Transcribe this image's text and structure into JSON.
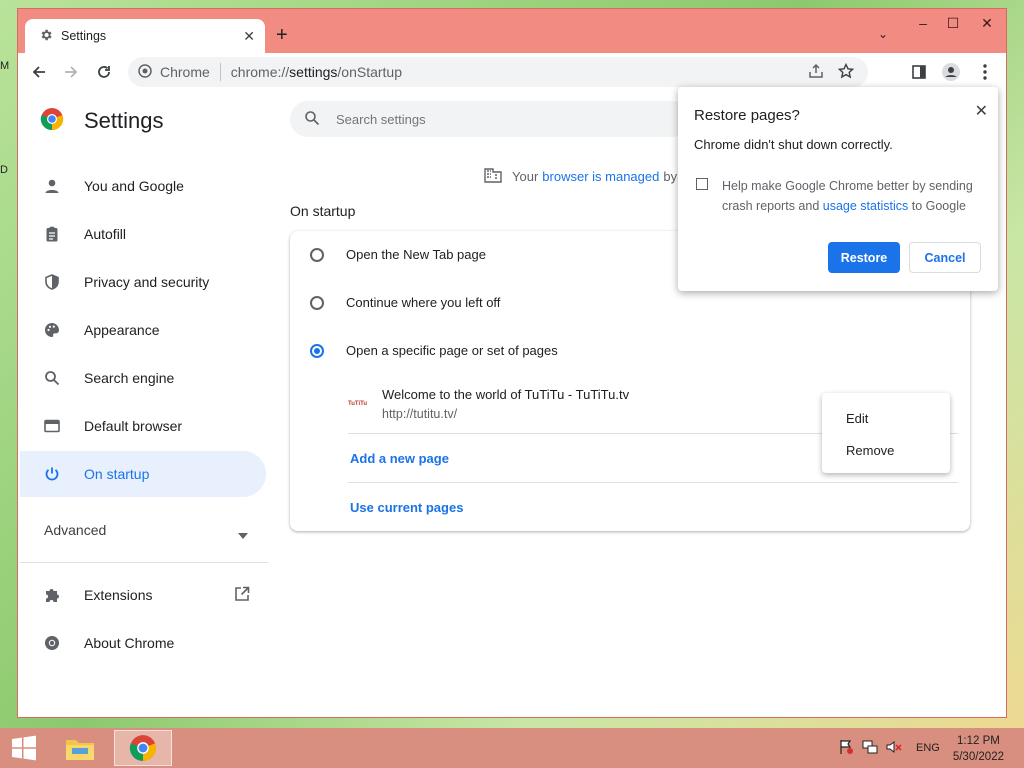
{
  "desktop": {
    "marks": [
      "M",
      "D"
    ]
  },
  "window": {
    "caption_buttons": {
      "minimize": "–",
      "maximize": "☐",
      "close": "✕"
    },
    "tab": {
      "title": "Settings",
      "close": "✕"
    },
    "new_tab": "+",
    "tab_search": "⌄"
  },
  "toolbar": {
    "omnibox": {
      "site": "Chrome",
      "url_prefix": "chrome://",
      "url_host": "settings",
      "url_path": "/onStartup"
    }
  },
  "sidebar": {
    "title": "Settings",
    "items": [
      {
        "label": "You and Google",
        "icon": "person-icon"
      },
      {
        "label": "Autofill",
        "icon": "clipboard-icon"
      },
      {
        "label": "Privacy and security",
        "icon": "shield-icon"
      },
      {
        "label": "Appearance",
        "icon": "palette-icon"
      },
      {
        "label": "Search engine",
        "icon": "search-icon"
      },
      {
        "label": "Default browser",
        "icon": "browser-window-icon"
      },
      {
        "label": "On startup",
        "icon": "power-icon",
        "active": true
      }
    ],
    "advanced": "Advanced",
    "extensions": "Extensions",
    "about": "About Chrome"
  },
  "search": {
    "placeholder": "Search settings"
  },
  "managed": {
    "prefix": "Your",
    "link": "browser is managed",
    "suffix": "by"
  },
  "startup": {
    "section_title": "On startup",
    "options": [
      "Open the New Tab page",
      "Continue where you left off",
      "Open a specific page or set of pages"
    ],
    "selected_index": 2,
    "page": {
      "favicon_text": "TuTiTu",
      "title": "Welcome to the world of TuTiTu - TuTiTu.tv",
      "url": "http://tutitu.tv/"
    },
    "add_page": "Add a new page",
    "use_current": "Use current pages"
  },
  "context_menu": {
    "items": [
      "Edit",
      "Remove"
    ]
  },
  "dialog": {
    "title": "Restore pages?",
    "close": "✕",
    "message": "Chrome didn't shut down correctly.",
    "checkbox_text_1": "Help make Google Chrome better by sending crash reports and",
    "checkbox_link": "usage statistics",
    "checkbox_text_2": "to Google",
    "checked": false,
    "restore": "Restore",
    "cancel": "Cancel"
  },
  "taskbar": {
    "language": "ENG",
    "time": "1:12 PM",
    "date": "5/30/2022"
  },
  "colors": {
    "accent": "#1a73e8",
    "window_frame": "#f28b82",
    "taskbar": "#d98f7f"
  }
}
